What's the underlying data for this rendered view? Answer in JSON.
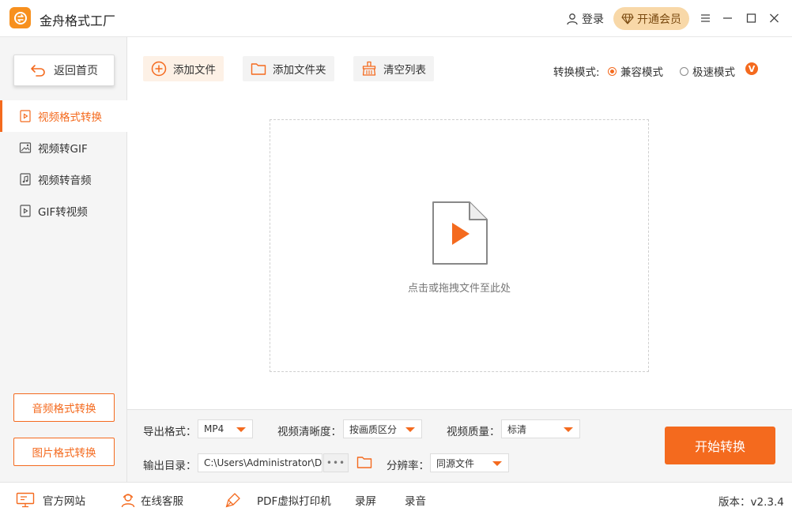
{
  "app": {
    "title": "金舟格式工厂"
  },
  "header": {
    "login": "登录",
    "vip": "开通会员"
  },
  "sidebar": {
    "home": "返回首页",
    "items": [
      {
        "label": "视频格式转换"
      },
      {
        "label": "视频转GIF"
      },
      {
        "label": "视频转音频"
      },
      {
        "label": "GIF转视频"
      }
    ],
    "bottom_buttons": [
      {
        "label": "音频格式转换"
      },
      {
        "label": "图片格式转换"
      }
    ]
  },
  "toolbar": {
    "add_file": "添加文件",
    "add_folder": "添加文件夹",
    "clear_list": "清空列表",
    "mode_label": "转换模式:",
    "mode_compatible": "兼容模式",
    "mode_fast": "极速模式",
    "v_badge": "V"
  },
  "dropzone": {
    "text": "点击或拖拽文件至此处"
  },
  "settings": {
    "format_label": "导出格式：",
    "format_value": "MP4",
    "clarity_label": "视频清晰度：",
    "clarity_value": "按画质区分",
    "quality_label": "视频质量：",
    "quality_value": "标清",
    "output_label": "输出目录：",
    "output_path": "C:\\Users\\Administrator\\De",
    "path_dots": "•••",
    "resolution_label": "分辨率：",
    "resolution_value": "同源文件",
    "start": "开始转换"
  },
  "footer": {
    "website": "官方网站",
    "service": "在线客服",
    "pdf_printer": "PDF虚拟打印机",
    "screen_record": "录屏",
    "audio_record": "录音",
    "version": "版本：v2.3.4"
  },
  "colors": {
    "accent": "#f46a1e",
    "vip_bg": "#f8d8a8"
  }
}
